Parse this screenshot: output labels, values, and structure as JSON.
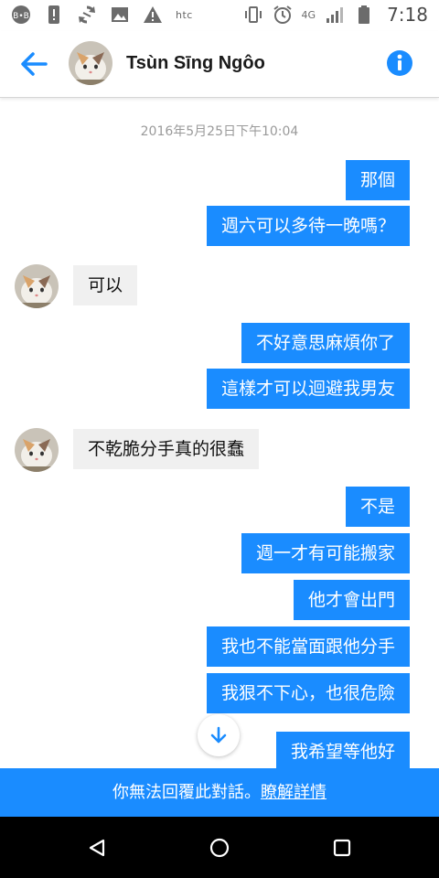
{
  "status_bar": {
    "carrier": "htc",
    "time": "7:18",
    "network": "4G",
    "icons": [
      "bb-icon",
      "alert-icon",
      "sync-icon",
      "image-icon",
      "warning-icon",
      "vibrate-icon",
      "alarm-icon",
      "signal-icon",
      "battery-icon"
    ]
  },
  "header": {
    "contact_name": "Tsùn Sīng Ngôo",
    "back_icon": "back-arrow-icon",
    "info_icon": "info-icon"
  },
  "conversation": {
    "timestamp": "2016年5月25日下午10:04",
    "messages": [
      {
        "from": "me",
        "text": "那個"
      },
      {
        "from": "me",
        "text": "週六可以多待一晚嗎？"
      },
      {
        "from": "them",
        "text": "可以"
      },
      {
        "from": "me",
        "text": "不好意思麻煩你了"
      },
      {
        "from": "me",
        "text": "這樣才可以迴避我男友"
      },
      {
        "from": "them",
        "text": "不乾脆分手真的很蠢"
      },
      {
        "from": "me",
        "text": "不是"
      },
      {
        "from": "me",
        "text": "週一才有可能搬家"
      },
      {
        "from": "me",
        "text": "他才會出門"
      },
      {
        "from": "me",
        "text": "我也不能當面跟他分手"
      },
      {
        "from": "me",
        "text": "我狠不下心，也很危險"
      },
      {
        "from": "me",
        "text": "我希望等他好"
      }
    ]
  },
  "footer": {
    "notice": "你無法回覆此對話。",
    "link": "瞭解詳情"
  },
  "colors": {
    "accent": "#1a8cff",
    "incoming_bubble": "#f0f0f0"
  }
}
